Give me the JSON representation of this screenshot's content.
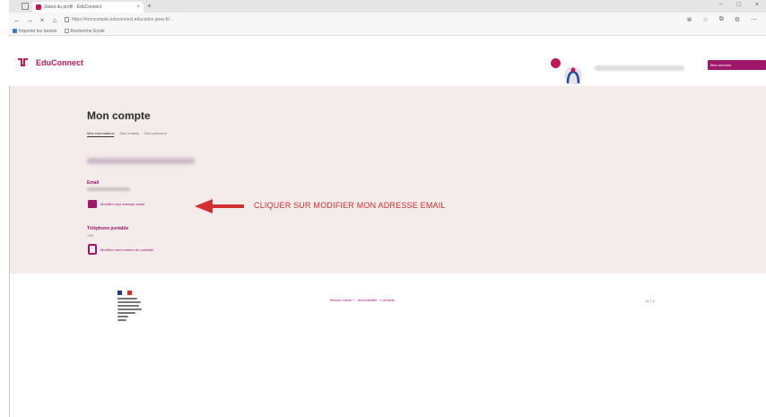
{
  "browser": {
    "tab_title": "Statut du profil - EduConnect",
    "url": "https://moncompte.educonnect.education.gouv.fr/...",
    "favorites": [
      "Importer les favoris",
      "Recherche Ecole"
    ],
    "newtab_glyph": "+",
    "controls": [
      "−",
      "□",
      "×"
    ]
  },
  "header": {
    "logo_text": "EduConnect",
    "cta_label": "Mes services"
  },
  "main": {
    "title": "Mon compte",
    "tabs": [
      "Mes informations",
      "Mes enfants",
      "Mon parcours"
    ],
    "email": {
      "label": "Email",
      "edit_link": "Modifier mon adresse email"
    },
    "phone": {
      "label": "Téléphone portable",
      "prefix": "+33",
      "edit_link": "Modifier mon numéro de portable"
    },
    "annotation": "CLIQUER SUR MODIFIER MON ADRESSE EMAIL"
  },
  "footer": {
    "links": "Besoin d'aide ? · Accessibilité · Contacts",
    "version": "v3.7.0"
  },
  "colors": {
    "brand": "#a0166a",
    "annotation": "#d32f2f",
    "main_bg": "#f4ebeb"
  }
}
